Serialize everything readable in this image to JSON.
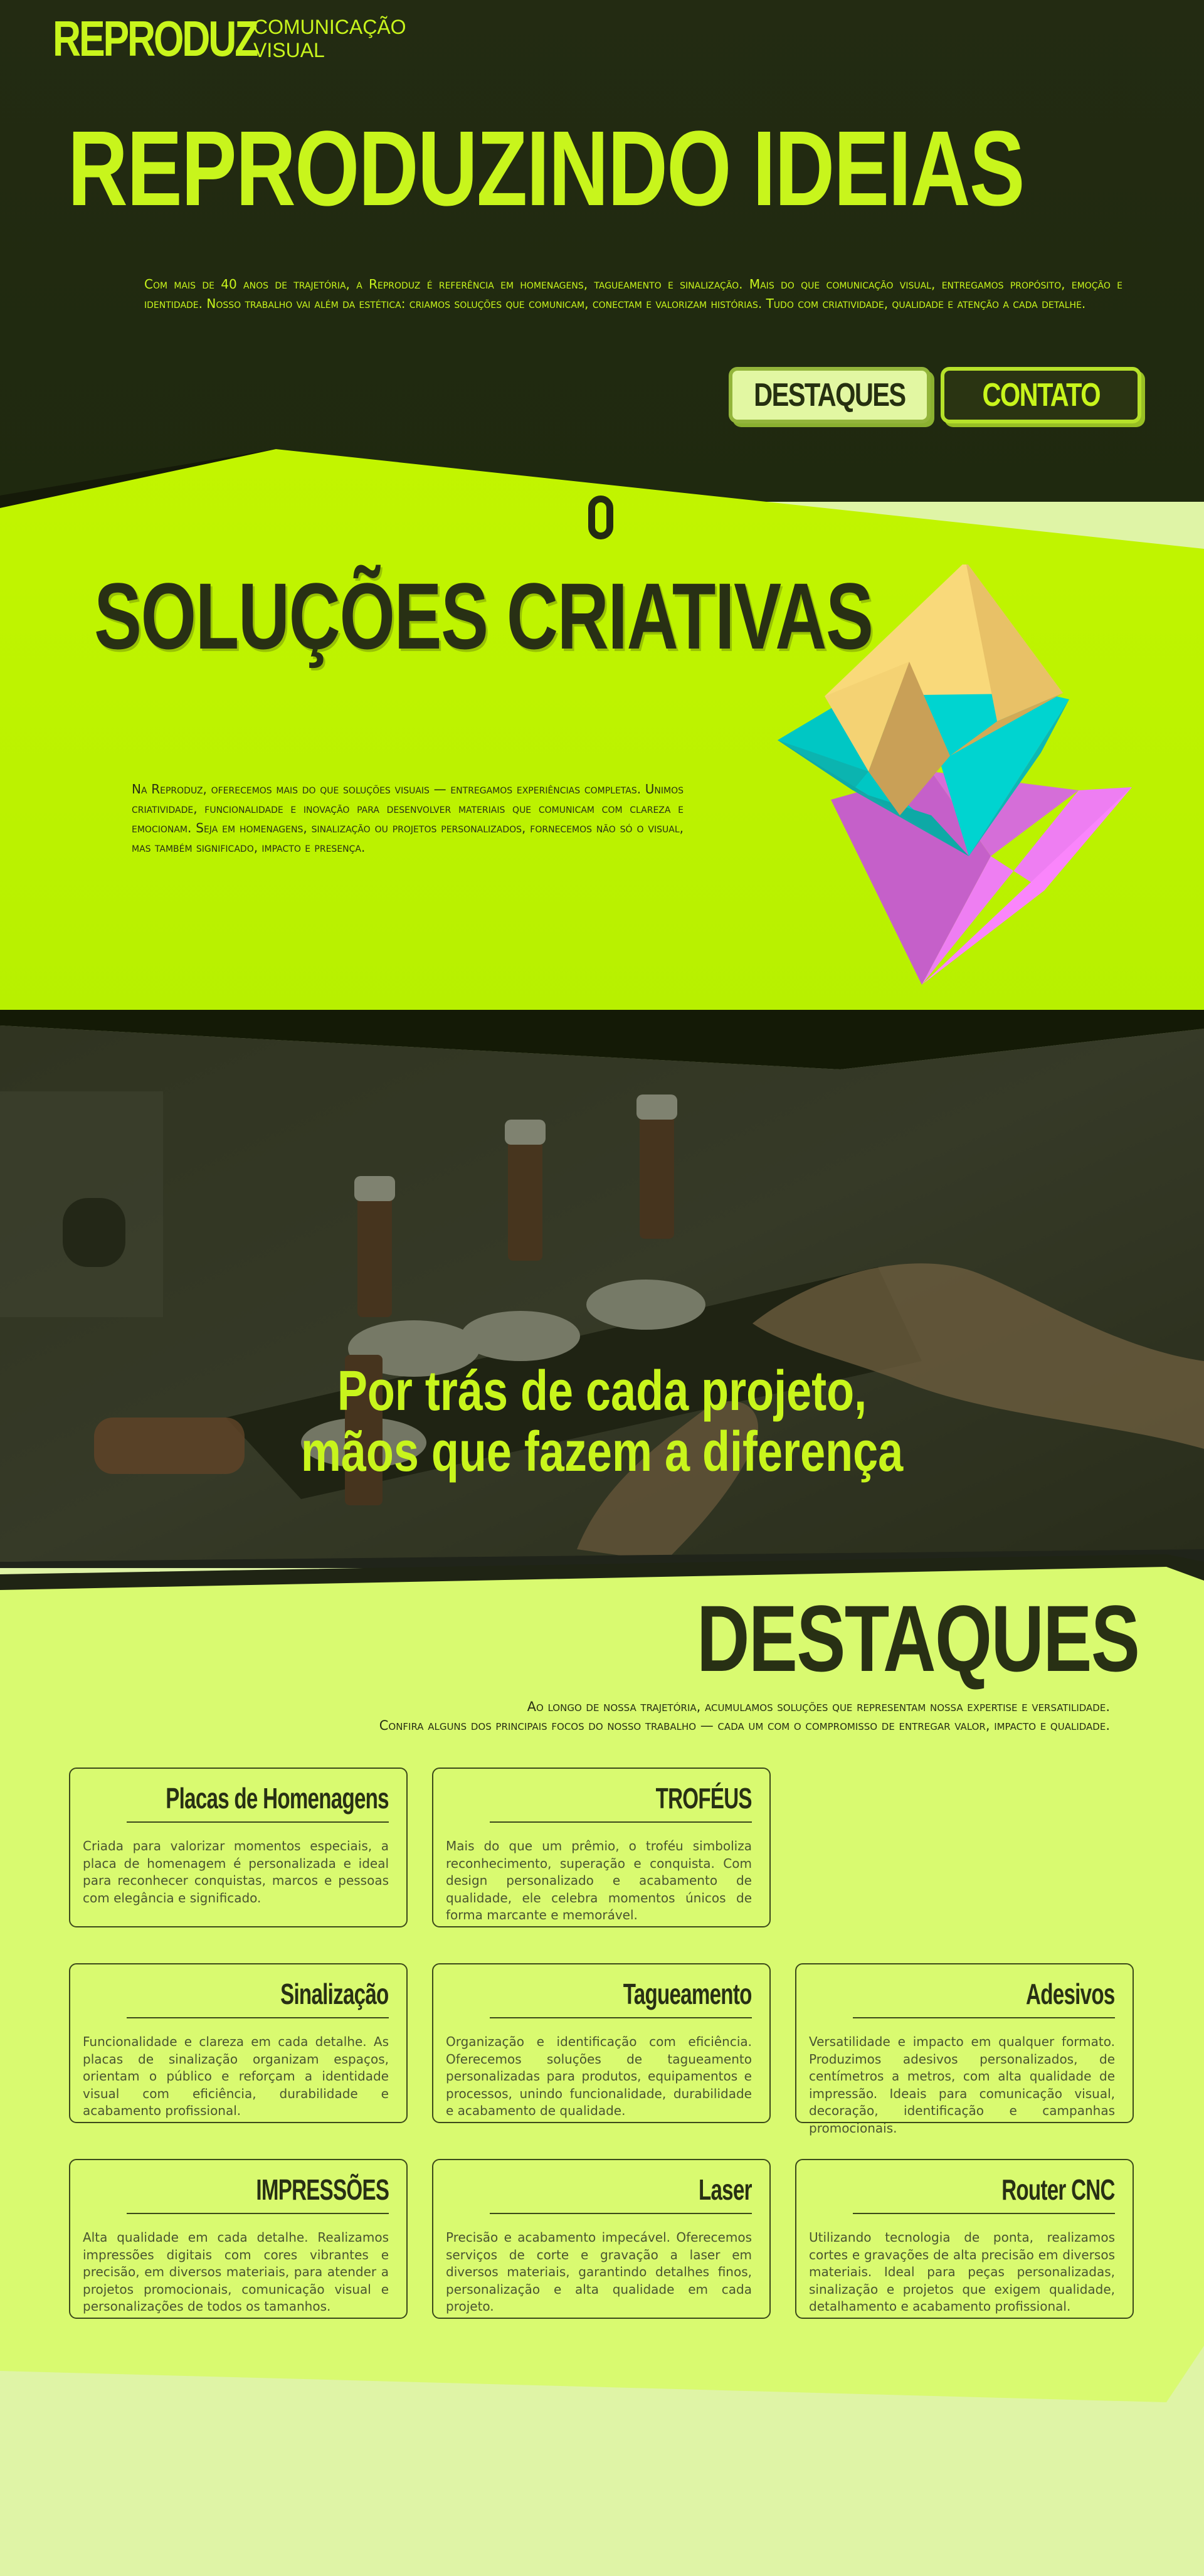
{
  "colors": {
    "dark": "#232b12",
    "lime": "#c8f51c",
    "pale": "#d9fa70"
  },
  "header": {
    "logo_main": "REPRODUZ",
    "logo_sub_1": "COMUNICAÇÃO",
    "logo_sub_2": "VISUAL"
  },
  "hero": {
    "title": "REPRODUZINDO IDEIAS",
    "text": "Com mais de 40 anos de trajetória, a Reproduz é referência em homenagens, tagueamento e sinalização. Mais do que comunicação visual, entregamos propósito, emoção e identidade. Nosso trabalho vai além da estética: criamos soluções que comunicam, conectam e valorizam histórias. Tudo com criatividade, qualidade e atenção a cada detalhe.",
    "btn_destaques": "DESTAQUES",
    "btn_contato": "CONTATO"
  },
  "solucoes": {
    "title": "SOLUÇÕES CRIATIVAS",
    "text": "Na Reproduz, oferecemos mais do que soluções visuais — entregamos experiências completas. Unimos criatividade, funcionalidade e inovação para desenvolver materiais que comunicam com clareza e emocionam. Seja em homenagens, sinalização ou projetos personalizados, fornecemos não só o visual, mas também significado, impacto e presença."
  },
  "photo": {
    "line1": "Por trás de cada projeto,",
    "line2": "mãos que fazem a diferença"
  },
  "destaques": {
    "title": "DESTAQUES",
    "intro1": "Ao longo de nossa trajetória, acumulamos soluções que representam nossa expertise e versatilidade.",
    "intro2": "Confira alguns dos principais focos do nosso trabalho — cada um com o compromisso de entregar valor, impacto e qualidade.",
    "cards": [
      {
        "title": "Placas de Homenagens",
        "desc": "Criada para valorizar momentos especiais, a placa de homenagem é personalizada e ideal para reconhecer conquistas, marcos e pessoas com elegância e significado."
      },
      {
        "title": "TROFÉUS",
        "desc": "Mais do que um prêmio, o troféu simboliza reconhecimento, superação e conquista. Com design personalizado e acabamento de qualidade, ele celebra momentos únicos de forma marcante e memorável."
      },
      {
        "title": "Sinalização",
        "desc": "Funcionalidade e clareza em cada detalhe. As placas de sinalização organizam espaços, orientam o público e reforçam a identidade visual com eficiência, durabilidade e acabamento profissional."
      },
      {
        "title": "Tagueamento",
        "desc": "Organização e identificação com eficiência. Oferecemos soluções de tagueamento personalizadas para produtos, equipamentos e processos, unindo funcionalidade, durabilidade e acabamento de qualidade."
      },
      {
        "title": "Adesivos",
        "desc": "Versatilidade e impacto em qualquer formato. Produzimos adesivos personalizados, de centímetros a metros, com alta qualidade de impressão. Ideais para comunicação visual, decoração, identificação e campanhas promocionais."
      },
      {
        "title": "IMPRESSÕES",
        "desc": "Alta qualidade em cada detalhe. Realizamos impressões digitais com cores vibrantes e precisão, em diversos materiais, para atender a projetos promocionais, comunicação visual e personalizações de todos os tamanhos."
      },
      {
        "title": "Laser",
        "desc": "Precisão e acabamento impecável. Oferecemos serviços de corte e gravação a laser em diversos materiais, garantindo detalhes finos, personalização e alta qualidade em cada projeto."
      },
      {
        "title": "Router CNC",
        "desc": "Utilizando tecnologia de ponta, realizamos cortes e gravações de alta precisão em diversos materiais. Ideal para peças personalizadas, sinalização e projetos que exigem qualidade, detalhamento e acabamento profissional."
      }
    ]
  }
}
